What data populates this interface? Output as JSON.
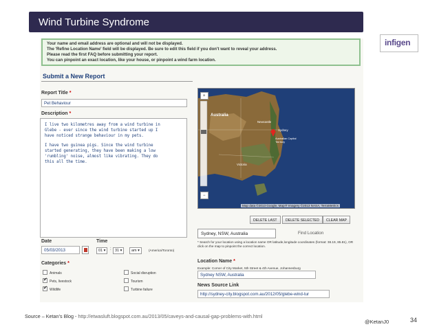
{
  "slide": {
    "title": "Wind Turbine Syndrome",
    "logo_text": "infigen",
    "source_label": "Source – Ketan’s Blog - ",
    "source_url": "http://etwasluft.blogspot.com.au/2013/05/caveys-and-causal-gap-problems-with.html",
    "handle": "@KetanJ0",
    "page_number": "34"
  },
  "form": {
    "notice_lines": [
      "Your name and email address are optional and will not be displayed.",
      "The 'Refine Location Name' field will be displayed. Be sure to edit this field if you don't want to reveal your address.",
      "Please read the first FAQ before submitting your report.",
      "You can pinpoint an exact location, like your house, or pinpoint a wind farm location."
    ],
    "heading": "Submit a New Report",
    "report_title_label": "Report Title",
    "report_title_value": "Pet Behaviour",
    "description_label": "Description",
    "description_paragraphs": [
      "I live two kilometres away from a wind turbine in\nGlebe - ever since the wind turbine started up I\nhave noticed strange behaviour in my pets.",
      "I have two guinea pigs. Since the wind turbine\nstarted generating, they have been making a low\n'rumbling' noise, almost like vibrating. They do\nthis all the time."
    ],
    "date_label": "Date",
    "date_value": "05/03/2013",
    "time_label": "Time",
    "time_hour": "01",
    "time_minute": "31",
    "time_ampm": "am",
    "timezone": "(America/Toronto)",
    "categories_label": "Categories",
    "categories": [
      {
        "label": "Animals",
        "checked": false
      },
      {
        "label": "Social disruption",
        "checked": false
      },
      {
        "label": "Pets, livestock",
        "checked": true
      },
      {
        "label": "Tourism",
        "checked": false
      },
      {
        "label": "Wildlife",
        "checked": true
      },
      {
        "label": "Turbine failure",
        "checked": false
      }
    ]
  },
  "map": {
    "zoom_in": "+",
    "zoom_out": "−",
    "credit": "Map data ©2013 Google, MapIT Imagery ©2013 NASA, TerraMetrics",
    "labels": {
      "country": "Australia",
      "city1": "Newcastle",
      "city2": "Sydney",
      "territory": "Australian Capital Territory",
      "state": "Victoria"
    },
    "buttons": {
      "delete_last": "DELETE LAST",
      "delete_selected": "DELETE SELECTED",
      "clear_map": "CLEAR MAP"
    },
    "location_value": "Sydney, NSW, Australia",
    "find_location": "Find Location",
    "hint": "* Search for your location using a location name OR latitude,longitude coordinates (format: 38.19, 85.81), OR click on the map to pinpoint the correct location."
  },
  "location_name": {
    "label": "Location Name",
    "example": "Example: Corner of City Market, 5th Street & 4th Avenue, Johannesburg",
    "value": "Sydney NSW, Australia"
  },
  "news": {
    "label": "News Source Link",
    "value": "http://sydney-city.blogspot.com.au/2012/05/glebe-wind-tur"
  }
}
